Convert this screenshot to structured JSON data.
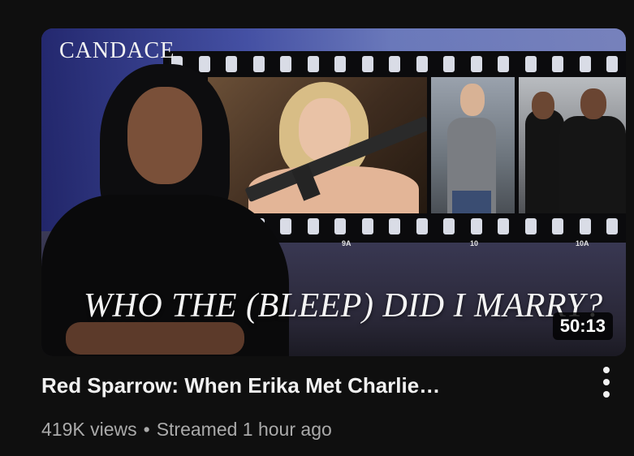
{
  "video": {
    "thumbnail": {
      "brand_text": "CANDACE",
      "headline": "WHO THE (BLEEP) DID I MARRY?",
      "film_frame_numbers": [
        "9A",
        "10",
        "10A"
      ],
      "duration": "50:13"
    },
    "title": "Red Sparrow: When Erika Met Charlie…",
    "views": "419K views",
    "separator": "•",
    "streamed": "Streamed 1 hour ago",
    "menu_icon": "more-vert-icon"
  },
  "colors": {
    "background": "#0f0f0f",
    "title": "#f1f1f1",
    "meta": "#aaaaaa"
  }
}
